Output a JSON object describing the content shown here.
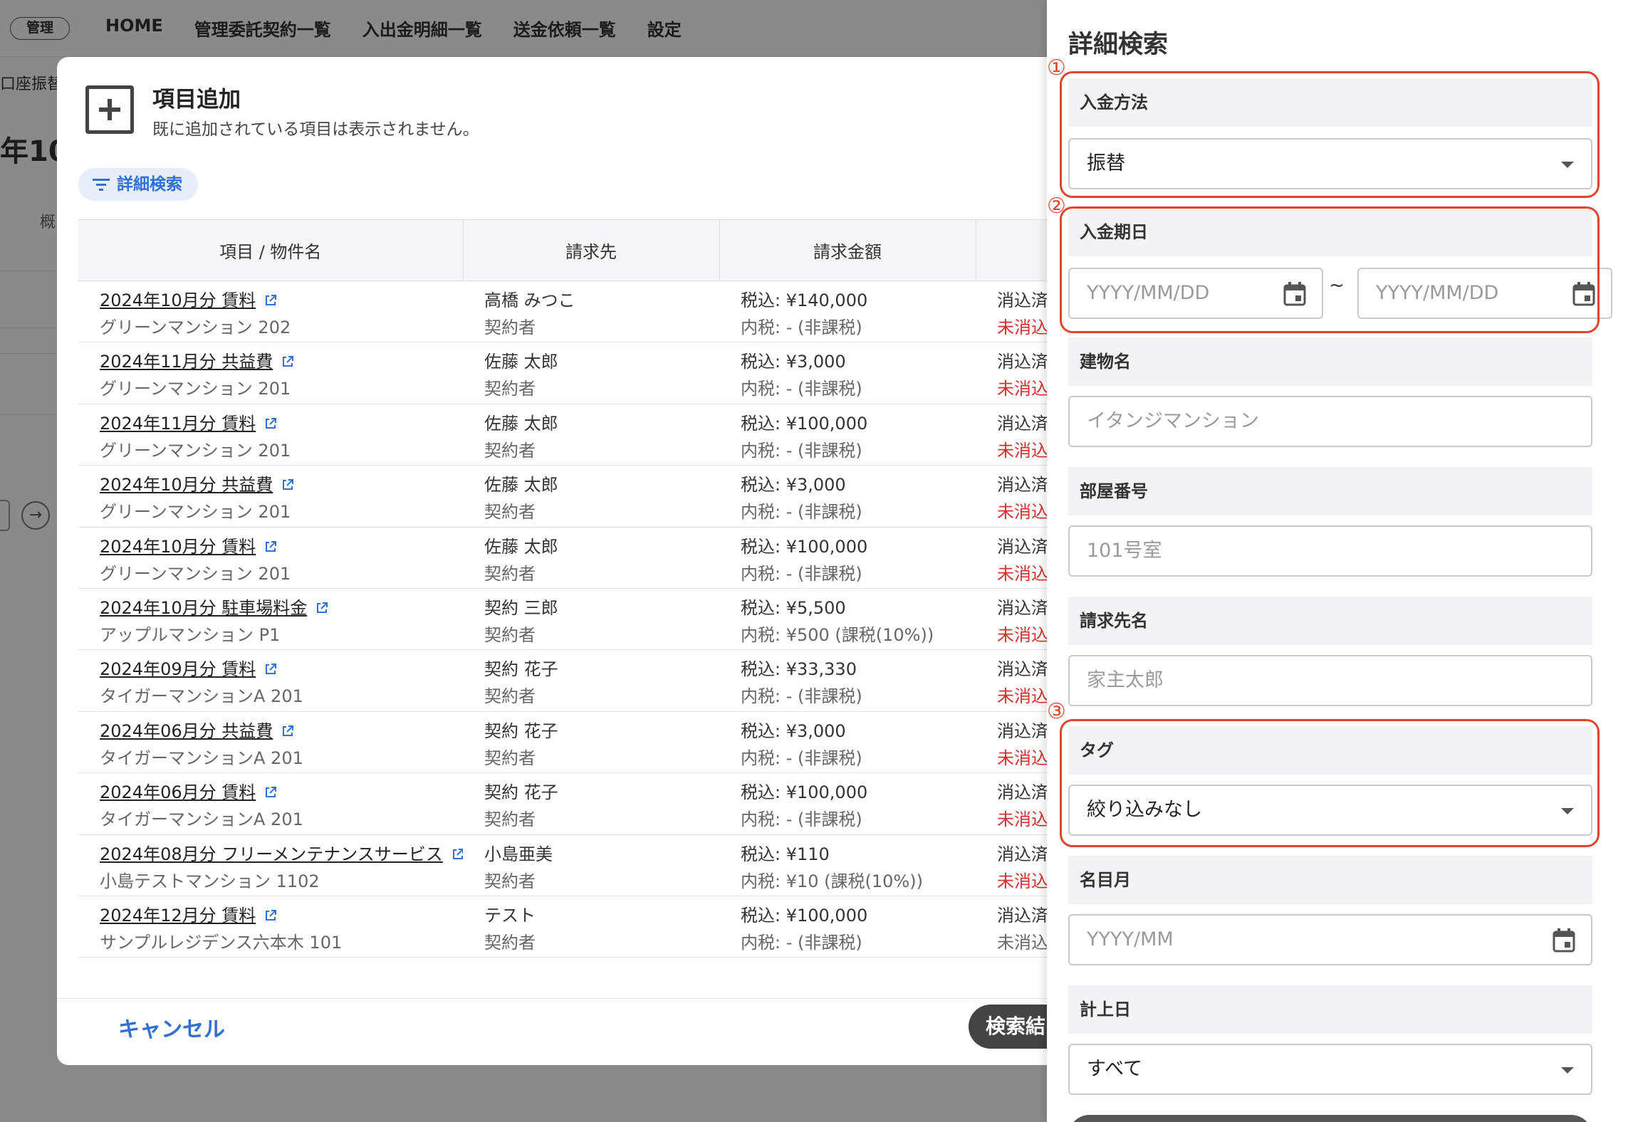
{
  "nav": {
    "badge": "管理",
    "items": [
      "HOME",
      "管理委託契約一覧",
      "入出金明細一覧",
      "送金依頼一覧",
      "設定"
    ]
  },
  "background": {
    "breadcrumb": "口座振替",
    "big_text": "年10.",
    "tab": "概"
  },
  "modal": {
    "title": "項目追加",
    "subtitle": "既に追加されている項目は表示されません。",
    "filter_chip": "詳細検索",
    "columns": [
      "項目 / 物件名",
      "請求先",
      "請求金額",
      ""
    ],
    "rows": [
      {
        "item": "2024年10月分 賃料",
        "property": "グリーンマンション 202",
        "billee": "高橋 みつこ",
        "role": "契約者",
        "amount": "税込: ¥140,000",
        "tax": "内税: - (非課税)",
        "status1": "消込済",
        "status2": "未消込"
      },
      {
        "item": "2024年11月分 共益費",
        "property": "グリーンマンション 201",
        "billee": "佐藤 太郎",
        "role": "契約者",
        "amount": "税込: ¥3,000",
        "tax": "内税: - (非課税)",
        "status1": "消込済",
        "status2": "未消込"
      },
      {
        "item": "2024年11月分 賃料",
        "property": "グリーンマンション 201",
        "billee": "佐藤 太郎",
        "role": "契約者",
        "amount": "税込: ¥100,000",
        "tax": "内税: - (非課税)",
        "status1": "消込済",
        "status2": "未消込"
      },
      {
        "item": "2024年10月分 共益費",
        "property": "グリーンマンション 201",
        "billee": "佐藤 太郎",
        "role": "契約者",
        "amount": "税込: ¥3,000",
        "tax": "内税: - (非課税)",
        "status1": "消込済",
        "status2": "未消込"
      },
      {
        "item": "2024年10月分 賃料",
        "property": "グリーンマンション 201",
        "billee": "佐藤 太郎",
        "role": "契約者",
        "amount": "税込: ¥100,000",
        "tax": "内税: - (非課税)",
        "status1": "消込済",
        "status2": "未消込"
      },
      {
        "item": "2024年10月分 駐車場料金",
        "property": "アップルマンション P1",
        "billee": "契約 三郎",
        "role": "契約者",
        "amount": "税込: ¥5,500",
        "tax": "内税: ¥500 (課税(10%))",
        "status1": "消込済",
        "status2": "未消込"
      },
      {
        "item": "2024年09月分 賃料",
        "property": "タイガーマンションA 201",
        "billee": "契約 花子",
        "role": "契約者",
        "amount": "税込: ¥33,330",
        "tax": "内税: - (非課税)",
        "status1": "消込済",
        "status2": "未消込"
      },
      {
        "item": "2024年06月分 共益費",
        "property": "タイガーマンションA 201",
        "billee": "契約 花子",
        "role": "契約者",
        "amount": "税込: ¥3,000",
        "tax": "内税: - (非課税)",
        "status1": "消込済",
        "status2": "未消込"
      },
      {
        "item": "2024年06月分 賃料",
        "property": "タイガーマンションA 201",
        "billee": "契約 花子",
        "role": "契約者",
        "amount": "税込: ¥100,000",
        "tax": "内税: - (非課税)",
        "status1": "消込済",
        "status2": "未消込"
      },
      {
        "item": "2024年08月分 フリーメンテナンスサービス",
        "property": "小島テストマンション 1102",
        "billee": "小島亜美",
        "role": "契約者",
        "amount": "税込: ¥110",
        "tax": "内税: ¥10 (課税(10%))",
        "status1": "消込済",
        "status2": "未消込"
      },
      {
        "item": "2024年12月分 賃料",
        "property": "サンプルレジデンス六本木 101",
        "billee": "テスト",
        "role": "契約者",
        "amount": "税込: ¥100,000",
        "tax": "内税: - (非課税)",
        "status1": "消込済",
        "status2": "未消込"
      }
    ],
    "cancel": "キャンセル",
    "search_results_button": "検索結"
  },
  "drawer": {
    "title": "詳細検索",
    "payment_method": {
      "label": "入金方法",
      "value": "振替"
    },
    "payment_due": {
      "label": "入金期日",
      "from_placeholder": "YYYY/MM/DD",
      "separator": "~",
      "to_placeholder": "YYYY/MM/DD"
    },
    "building": {
      "label": "建物名",
      "placeholder": "イタンジマンション"
    },
    "room": {
      "label": "部屋番号",
      "placeholder": "101号室"
    },
    "billee_name": {
      "label": "請求先名",
      "placeholder": "家主太郎"
    },
    "tag": {
      "label": "タグ",
      "value": "絞り込みなし"
    },
    "nominal_month": {
      "label": "名目月",
      "placeholder": "YYYY/MM"
    },
    "posting_date": {
      "label": "計上日",
      "value": "すべて"
    }
  },
  "annotations": [
    "①",
    "②",
    "③"
  ],
  "colors": {
    "annotation": "#e0452d",
    "link": "#2f6fd6",
    "status_red": "#d62d2d"
  }
}
